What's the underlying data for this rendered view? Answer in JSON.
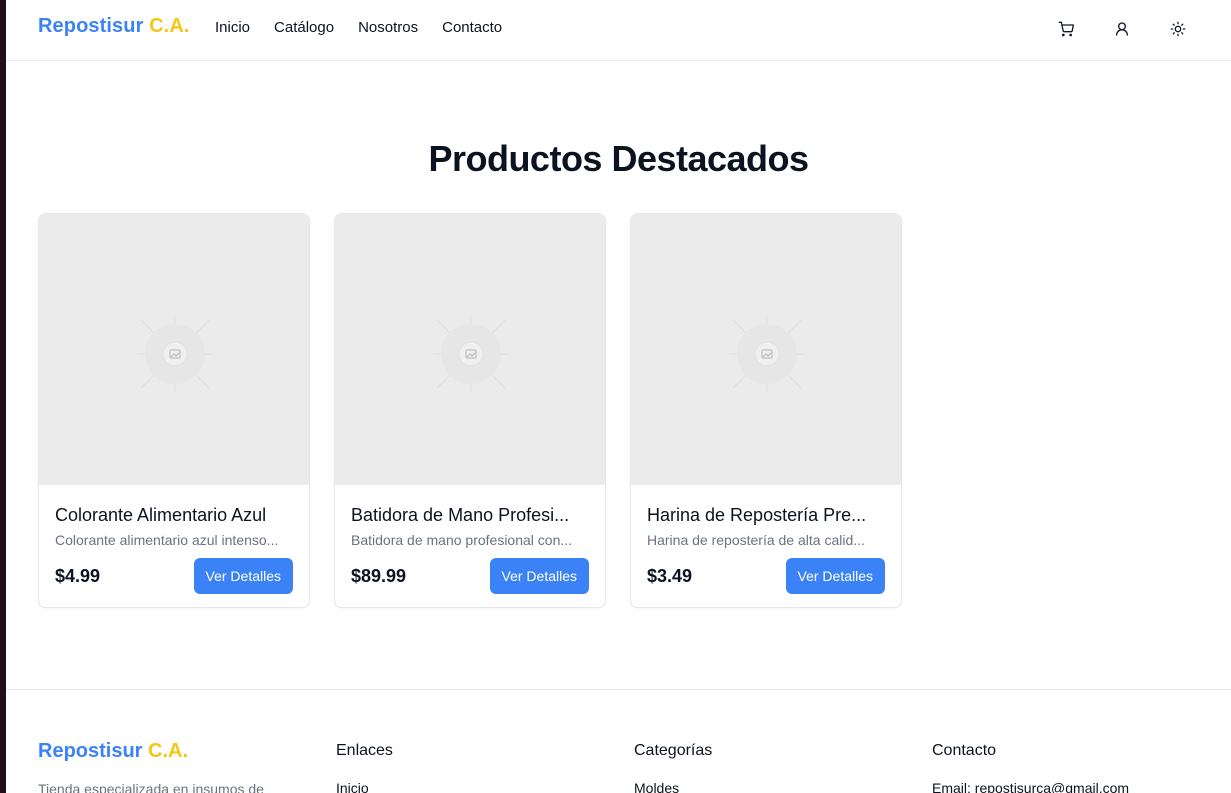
{
  "header": {
    "logo_a": "Repostisur",
    "logo_b": "C.A.",
    "nav": [
      "Inicio",
      "Catálogo",
      "Nosotros",
      "Contacto"
    ],
    "icons": [
      "cart-icon",
      "user-icon",
      "sun-icon"
    ]
  },
  "main": {
    "title": "Productos Destacados",
    "products": [
      {
        "name": "Colorante Alimentario Azul",
        "description": "Colorante alimentario azul intenso...",
        "price": "$4.99",
        "button": "Ver Detalles"
      },
      {
        "name": "Batidora de Mano Profesi...",
        "description": "Batidora de mano profesional con...",
        "price": "$89.99",
        "button": "Ver Detalles"
      },
      {
        "name": "Harina de Repostería Pre...",
        "description": "Harina de repostería de alta calid...",
        "price": "$3.49",
        "button": "Ver Detalles"
      }
    ]
  },
  "footer": {
    "logo_a": "Repostisur",
    "logo_b": "C.A.",
    "tagline": "Tienda especializada en insumos de",
    "links_heading": "Enlaces",
    "links_first": "Inicio",
    "categories_heading": "Categorías",
    "categories_first": "Moldes",
    "contact_heading": "Contacto",
    "contact_email": "Email: repostisurca@gmail.com"
  },
  "colors": {
    "accent": "#3b82f6",
    "brand_yellow": "#f5c518"
  }
}
